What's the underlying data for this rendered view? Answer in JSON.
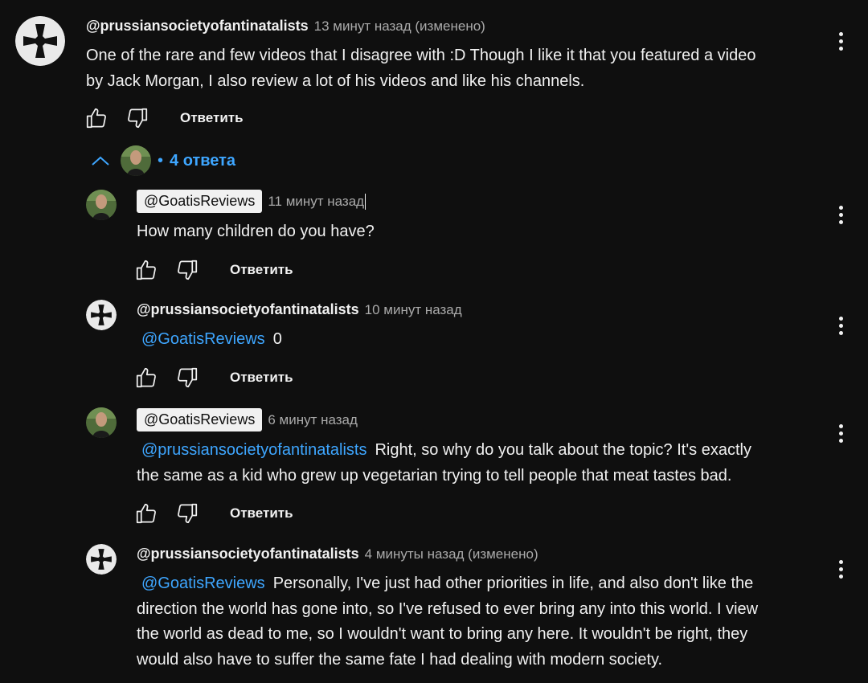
{
  "top_comment": {
    "author": "@prussiansocietyofantinatalists",
    "time": "13 минут назад (изменено)",
    "text_line1": "One of the rare and few videos that I disagree with :D Though I like it that you featured a video",
    "text_line2": "by Jack Morgan, I also review a lot of his videos and like his channels.",
    "reply_label": "Ответить"
  },
  "replies_toggle": {
    "separator": "•",
    "count_label": "4 ответа"
  },
  "replies": [
    {
      "author": "@GoatisReviews",
      "time": "11 минут назад",
      "mention": "",
      "text_line1": "How many children do you have?",
      "text_line2": "",
      "reply_label": "Ответить"
    },
    {
      "author": "@prussiansocietyofantinatalists",
      "time": "10 минут назад",
      "mention": "@GoatisReviews",
      "text_line1": "0",
      "text_line2": "",
      "reply_label": "Ответить"
    },
    {
      "author": "@GoatisReviews",
      "time": "6 минут назад",
      "mention": "@prussiansocietyofantinatalists",
      "text_line1": "Right, so why do you talk about the topic? It's exactly",
      "text_line2": "the same as a kid who grew up vegetarian trying to tell people that meat tastes bad.",
      "reply_label": "Ответить"
    },
    {
      "author": "@prussiansocietyofantinatalists",
      "time": "4 минуты назад (изменено)",
      "mention": "@GoatisReviews",
      "text_line1": "Personally, I've just had other priorities in life, and also don't like the",
      "text_line2": "direction the world has gone into, so I've refused to ever bring any into this world. I view",
      "text_line3": "the world as dead to me, so I wouldn't want to bring any here. It wouldn't be right, they",
      "text_line4": "would also have to suffer the same fate I had dealing with modern society."
    }
  ],
  "colors": {
    "background": "#0f0f0f",
    "text": "#f1f1f1",
    "meta": "#aaaaaa",
    "link": "#3ea6ff"
  },
  "icons": [
    "cross-avatar-icon",
    "person-avatar-icon",
    "thumbs-up-icon",
    "thumbs-down-icon",
    "more-vert-icon",
    "chevron-up-icon"
  ]
}
